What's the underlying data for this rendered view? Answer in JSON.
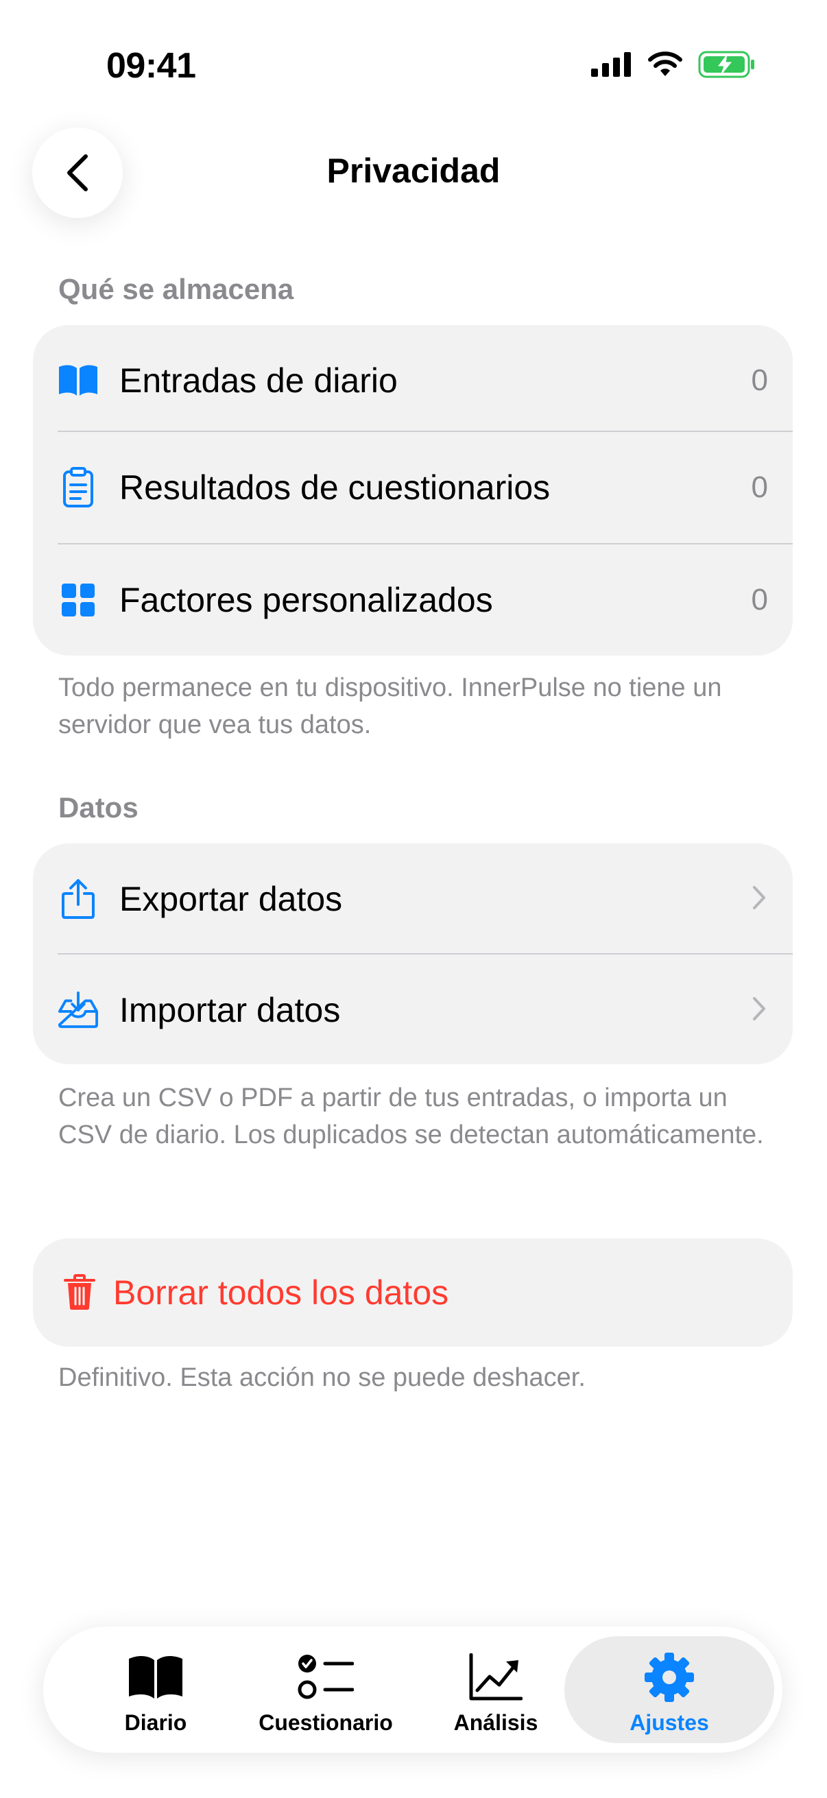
{
  "status_bar": {
    "time": "09:41"
  },
  "nav": {
    "title": "Privacidad"
  },
  "stored_section": {
    "header": "Qué se almacena",
    "rows": [
      {
        "label": "Entradas de diario",
        "value": "0",
        "icon": "book-icon"
      },
      {
        "label": "Resultados de cuestionarios",
        "value": "0",
        "icon": "clipboard-icon"
      },
      {
        "label": "Factores personalizados",
        "value": "0",
        "icon": "grid-icon"
      }
    ],
    "footnote": "Todo permanece en tu dispositivo. InnerPulse no tiene un servidor que vea tus datos."
  },
  "data_section": {
    "header": "Datos",
    "rows": [
      {
        "label": "Exportar datos",
        "icon": "share-icon"
      },
      {
        "label": "Importar datos",
        "icon": "tray-download-icon"
      }
    ],
    "footnote": "Crea un CSV o PDF a partir de tus entradas, o importa un CSV de diario. Los duplicados se detectan automáticamente."
  },
  "danger_section": {
    "label": "Borrar todos los datos",
    "icon": "trash-icon",
    "footnote": "Definitivo. Esta acción no se puede deshacer."
  },
  "tab_bar": {
    "tabs": [
      {
        "label": "Diario",
        "icon": "book-icon"
      },
      {
        "label": "Cuestionario",
        "icon": "checklist-icon"
      },
      {
        "label": "Análisis",
        "icon": "chart-icon"
      },
      {
        "label": "Ajustes",
        "icon": "gear-icon",
        "active": true
      }
    ]
  },
  "colors": {
    "accent": "#0a84ff",
    "danger": "#ff3b30",
    "secondary_text": "#8a8a8e",
    "card_background": "#f2f2f2",
    "battery_green": "#34c759"
  }
}
